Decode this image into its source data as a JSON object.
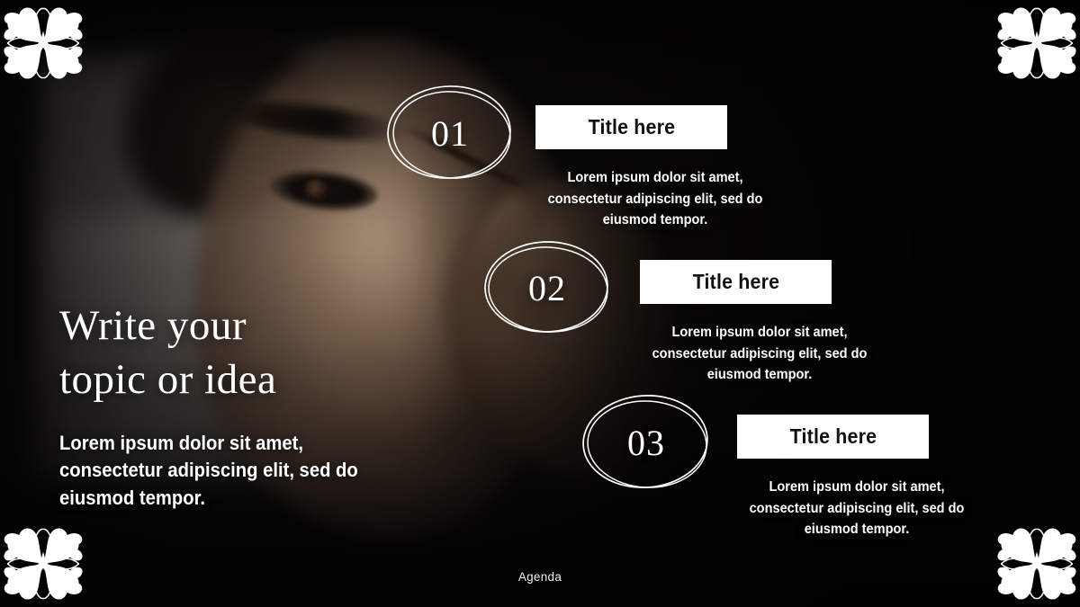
{
  "slide": {
    "footer_label": "Agenda",
    "headline_line1": "Write your",
    "headline_line2": "topic or idea",
    "lead_paragraph": "Lorem ipsum dolor sit amet, consectetur adipiscing elit, sed do eiusmod tempor.",
    "background_description": "Dark moody photograph of a person applying eyeliner in front of a mirror"
  },
  "items": [
    {
      "number": "01",
      "title": "Title here",
      "description": "Lorem ipsum dolor sit amet, consectetur adipiscing elit, sed do eiusmod tempor."
    },
    {
      "number": "02",
      "title": "Title here",
      "description": "Lorem ipsum dolor sit amet, consectetur adipiscing elit, sed do eiusmod tempor."
    },
    {
      "number": "03",
      "title": "Title here",
      "description": "Lorem ipsum dolor sit amet, consectetur adipiscing elit, sed do eiusmod tempor."
    }
  ],
  "ornaments": {
    "icon_name": "floral-corner-ornament",
    "positions": [
      "top-left",
      "top-right",
      "bottom-left",
      "bottom-right"
    ]
  },
  "colors": {
    "background": "#0a0908",
    "text_primary": "#ffffff",
    "chip_background": "#ffffff",
    "chip_text": "#111111",
    "ornament": "#ffffff"
  }
}
